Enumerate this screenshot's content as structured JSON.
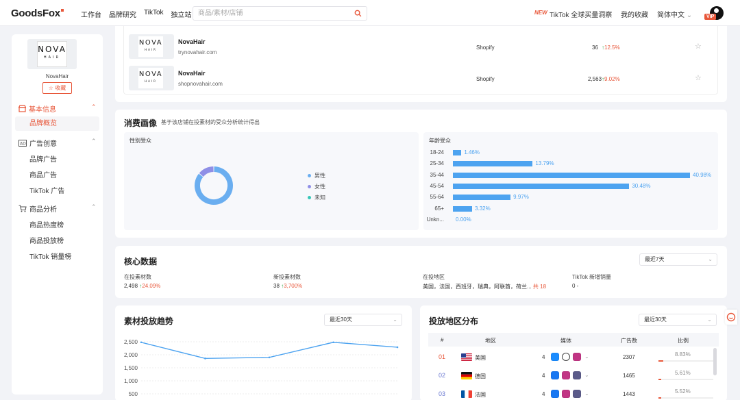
{
  "topbar": {
    "logo": "GoodsFox",
    "nav": [
      "工作台",
      "品牌研究",
      "TikTok",
      "独立站"
    ],
    "search_placeholder": "商品/素材/店铺",
    "new_badge": "NEW",
    "tiktok_link": "TikTok 全球买量洞察",
    "favorites": "我的收藏",
    "language": "简体中文",
    "vip": "VIP"
  },
  "sidebar": {
    "brand_logo_line1": "NOVA",
    "brand_logo_line2": "HAIR",
    "brand_name": "NovaHair",
    "fav_button": "收藏",
    "sections": [
      {
        "label": "基本信息",
        "items": [
          "品牌概览"
        ]
      },
      {
        "label": "广告创意",
        "items": [
          "品牌广告",
          "商品广告",
          "TikTok 广告"
        ]
      },
      {
        "label": "商品分析",
        "items": [
          "商品热度榜",
          "商品投放榜",
          "TikTok 销量榜"
        ]
      }
    ]
  },
  "stores": [
    {
      "name": "NovaHair",
      "url": "trynovahair.com",
      "platform": "Shopify",
      "count": "36",
      "growth": "12.5%"
    },
    {
      "name": "NovaHair",
      "url": "shopnovahair.com",
      "platform": "Shopify",
      "count": "2,563",
      "growth": "9.02%"
    }
  ],
  "portrait": {
    "title": "消费画像",
    "subtitle": "基于该店铺在投素材的受众分析统计得出",
    "gender_label": "性别受众",
    "gender_legend": [
      "男性",
      "女性",
      "未知"
    ],
    "gender_data": [
      0.86,
      0.14,
      0.0
    ],
    "gender_colors": [
      "#6aaef0",
      "#8f8fe6",
      "#37c6b8"
    ],
    "age_label": "年龄受众",
    "ages": [
      {
        "label": "18-24",
        "value": 1.46,
        "text": "1.46%"
      },
      {
        "label": "25-34",
        "value": 13.79,
        "text": "13.79%"
      },
      {
        "label": "35-44",
        "value": 40.98,
        "text": "40.98%"
      },
      {
        "label": "45-54",
        "value": 30.48,
        "text": "30.48%"
      },
      {
        "label": "55-64",
        "value": 9.97,
        "text": "9.97%"
      },
      {
        "label": "65+",
        "value": 3.32,
        "text": "3.32%"
      },
      {
        "label": "Unkn...",
        "value": 0.0,
        "text": "0.00%"
      }
    ]
  },
  "core": {
    "title": "核心数据",
    "range": "最近7天",
    "kpis": [
      {
        "label": "在投素材数",
        "value": "2,498",
        "growth": "24.09%"
      },
      {
        "label": "新投素材数",
        "value": "38",
        "growth": "3,700%"
      },
      {
        "label": "在投地区",
        "value": "美国，法国，西班牙，瑞典，阿联酋，荷兰...",
        "extra": "共 18"
      },
      {
        "label": "TikTok 新增销量",
        "value": "0 -"
      }
    ]
  },
  "trend": {
    "title": "素材投放趋势",
    "range": "最近30天",
    "yticks": [
      "2,500",
      "2,000",
      "1,500",
      "1,000",
      "500"
    ],
    "chart_data": {
      "type": "line",
      "y": [
        2480,
        1860,
        1900,
        2480,
        2290
      ],
      "ylim": [
        0,
        2500
      ]
    }
  },
  "regions": {
    "title": "投放地区分布",
    "range": "最近30天",
    "headers": [
      "#",
      "地区",
      "媒体",
      "广告数",
      "比例"
    ],
    "rows": [
      {
        "rank": "01",
        "country": "美国",
        "media_count": "4",
        "ads": "2307",
        "ratio": "8.83%",
        "ratio_value": 8.83
      },
      {
        "rank": "02",
        "country": "德国",
        "media_count": "4",
        "ads": "1465",
        "ratio": "5.61%",
        "ratio_value": 5.61
      },
      {
        "rank": "03",
        "country": "法国",
        "media_count": "4",
        "ads": "1443",
        "ratio": "5.52%",
        "ratio_value": 5.52
      }
    ]
  }
}
